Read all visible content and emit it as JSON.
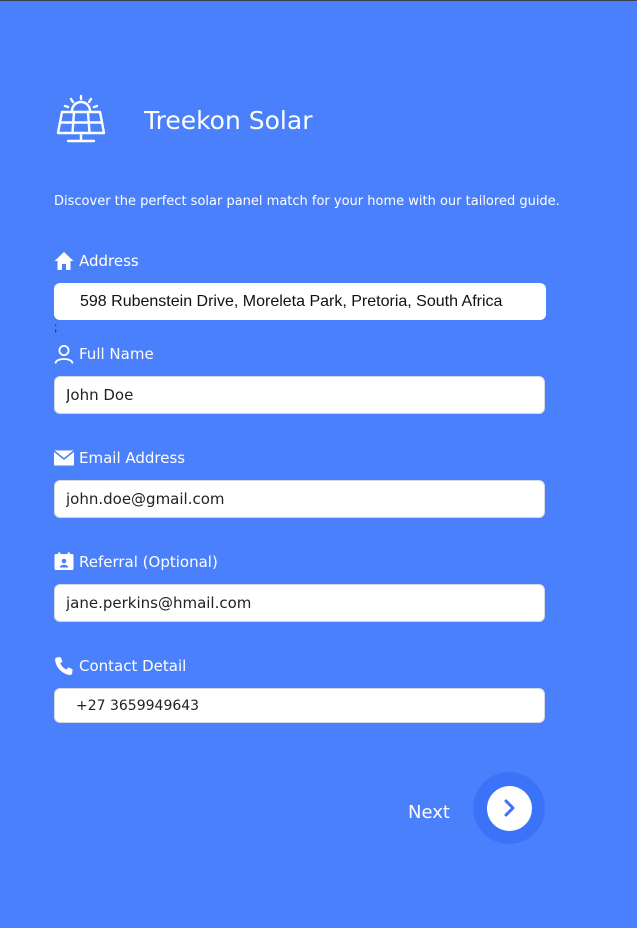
{
  "brand": {
    "name": "Treekon Solar",
    "logo_icon": "solar-panel-icon"
  },
  "tagline": "Discover the perfect solar panel match for your home with our tailored guide.",
  "fields": {
    "address": {
      "label": "Address",
      "icon": "home-icon",
      "value": "598 Rubenstein Drive, Moreleta Park, Pretoria, South Africa"
    },
    "full_name": {
      "label": "Full Name",
      "icon": "user-icon",
      "value": "John Doe"
    },
    "email": {
      "label": "Email Address",
      "icon": "envelope-icon",
      "value": "john.doe@gmail.com"
    },
    "referral": {
      "label": "Referral (Optional)",
      "icon": "referral-icon",
      "value": "jane.perkins@hmail.com"
    },
    "contact": {
      "label": "Contact Detail",
      "icon": "phone-icon",
      "value": "+27 3659949643"
    }
  },
  "stray_mark": ";",
  "navigation": {
    "next_label": "Next",
    "next_icon": "chevron-right-icon"
  },
  "colors": {
    "background": "#4a80fb",
    "button_ring": "#3b73f8",
    "text": "#ffffff"
  }
}
